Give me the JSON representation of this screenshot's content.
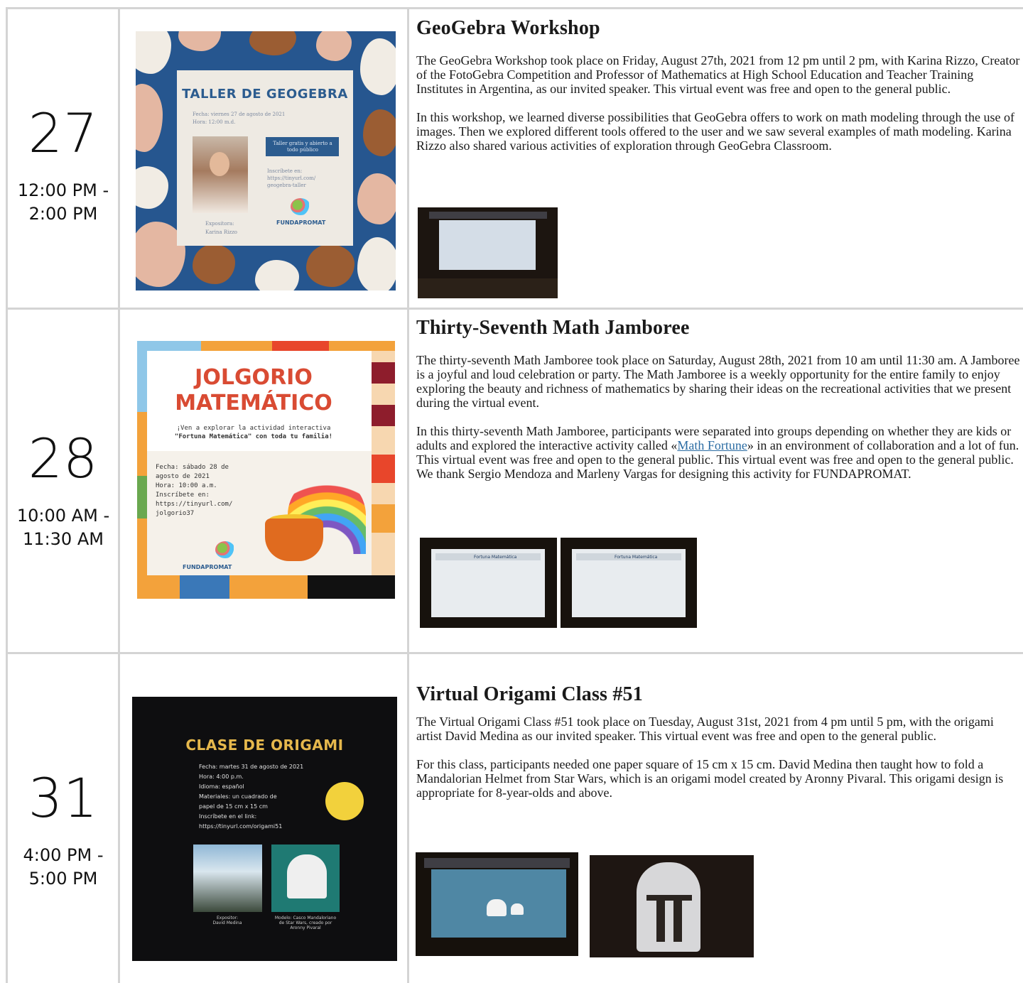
{
  "events": [
    {
      "day": "27",
      "time_start": "12:00 PM -",
      "time_end": "2:00 PM",
      "title": "GeoGebra Workshop",
      "p1": "The GeoGebra Workshop took place on Friday, August 27th, 2021 from 12 pm until 2 pm, with Karina Rizzo, Creator of the FotoGebra Competition and Professor of Mathematics at High School Education and Teacher Training Institutes in Argentina, as our invited speaker. This virtual event was free and open to the general public.",
      "p2": "In this workshop, we learned diverse possibilities that GeoGebra offers to work on math modeling through the use of images. Then we explored different tools offered to the user and we saw several examples of math modeling. Karina Rizzo also shared various activities of exploration through GeoGebra Classroom.",
      "poster": {
        "title": "TALLER DE GEOGEBRA",
        "line1": "Fecha: viernes 27 de agosto de 2021",
        "line2": "Hora: 12:00 m.d.",
        "box": "Taller gratis y abierto a todo público",
        "reg1": "Inscríbete en:",
        "reg2": "https://tinyurl.com/",
        "reg3": "geogebra-taller",
        "spk1": "Expositora:",
        "spk2": "Karina Rizzo",
        "brand": "FUNDAPROMAT"
      }
    },
    {
      "day": "28",
      "time_start": "10:00 AM -",
      "time_end": "11:30 AM",
      "title": "Thirty-Seventh Math Jamboree",
      "p1": "The thirty-seventh Math Jamboree took place on Saturday, August 28th, 2021 from 10 am until 11:30 am. A Jamboree is a joyful and loud celebration or party. The Math Jamboree is a weekly opportunity for the entire family to enjoy exploring the beauty and richness of mathematics by sharing their ideas on the recreational activities that we present during the virtual event.",
      "p2_before": "In this thirty-seventh Math Jamboree, participants were separated into groups depending on whether they are kids or adults and explored the interactive activity called «",
      "p2_link": "Math Fortune",
      "p2_after": "» in an environment of collaboration and a lot of fun. This virtual event was free and open to the general public. This virtual event was free and open to the general public. We thank Sergio Mendoza and Marleny Vargas for designing this activity for FUNDAPROMAT.",
      "poster": {
        "title1": "JOLGORIO",
        "title2": "MATEMÁTICO",
        "sub1": "¡Ven a explorar la actividad interactiva",
        "sub2": "\"Fortuna Matemática\" con toda tu familia!",
        "info": "Fecha: sábado 28 de\nagosto de 2021\nHora: 10:00 a.m.\nInscríbete en:\nhttps://tinyurl.com/\njolgorio37",
        "brand": "FUNDAPROMAT"
      },
      "screen_label": "Fortuna Matemática"
    },
    {
      "day": "31",
      "time_start": "4:00 PM -",
      "time_end": "5:00 PM",
      "title": "Virtual Origami Class #51",
      "p1": "The Virtual Origami Class #51 took place on Tuesday, August 31st, 2021 from 4 pm until 5 pm, with the origami artist David Medina as our invited speaker. This virtual event was free and open to the general public.",
      "p2": "For this class, participants needed one paper square of 15 cm x 15 cm. David Medina then taught how to fold a Mandalorian Helmet from Star Wars, which is an origami model created by Aronny Pivaral. This origami design is appropriate for 8-year-olds and above.",
      "poster": {
        "title": "CLASE DE ORIGAMI",
        "info": "Fecha: martes 31 de agosto de 2021\nHora: 4:00 p.m.\nIdioma: español\nMateriales: un cuadrado de\npapel de 15 cm x 15 cm\nInscríbete en el link:\nhttps://tinyurl.com/origami51",
        "cap1": "Expositor:\nDavid Medina",
        "cap2": "Modelo: Casco Mandaloriano\nde Star Wars, creado por\nAronny Pivaral"
      }
    }
  ],
  "colors": {
    "grid": "#d4d4d4",
    "link": "#2b6ca3",
    "poster1_bg": "#26568f",
    "poster2_title": "#d94b33",
    "poster3_title": "#e6b84c"
  }
}
